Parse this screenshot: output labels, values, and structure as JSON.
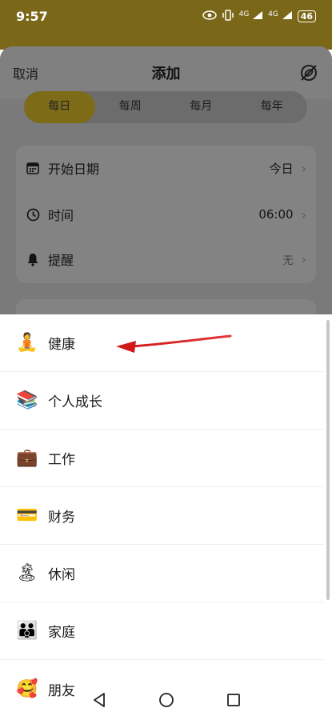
{
  "status_bar": {
    "time": "9:57",
    "network_1": "4G",
    "network_2": "4G",
    "battery": "46"
  },
  "header": {
    "cancel_label": "取消",
    "title": "添加",
    "right_icon": "eye-off-icon"
  },
  "frequency_tabs": [
    {
      "label": "每日",
      "active": true
    },
    {
      "label": "每周",
      "active": false
    },
    {
      "label": "每月",
      "active": false
    },
    {
      "label": "每年",
      "active": false
    }
  ],
  "settings": {
    "start_date": {
      "label": "开始日期",
      "value": "今日",
      "icon": "calendar-icon"
    },
    "time": {
      "label": "时间",
      "value": "06:00",
      "icon": "clock-icon"
    },
    "reminder": {
      "label": "提醒",
      "value": "无",
      "icon": "bell-icon"
    }
  },
  "categories": [
    {
      "label": "健康",
      "icon": "meditation-icon",
      "emoji": "🧘"
    },
    {
      "label": "个人成长",
      "icon": "books-icon",
      "emoji": "📚"
    },
    {
      "label": "工作",
      "icon": "briefcase-icon",
      "emoji": "💼"
    },
    {
      "label": "财务",
      "icon": "credit-card-icon",
      "emoji": "💳"
    },
    {
      "label": "休闲",
      "icon": "beach-icon",
      "emoji": "🏝"
    },
    {
      "label": "家庭",
      "icon": "family-icon",
      "emoji": "👪"
    },
    {
      "label": "朋友",
      "icon": "smiling-hearts-icon",
      "emoji": "🥰"
    }
  ],
  "colors": {
    "accent": "#f2c94c",
    "annotation_arrow": "#d32020"
  }
}
